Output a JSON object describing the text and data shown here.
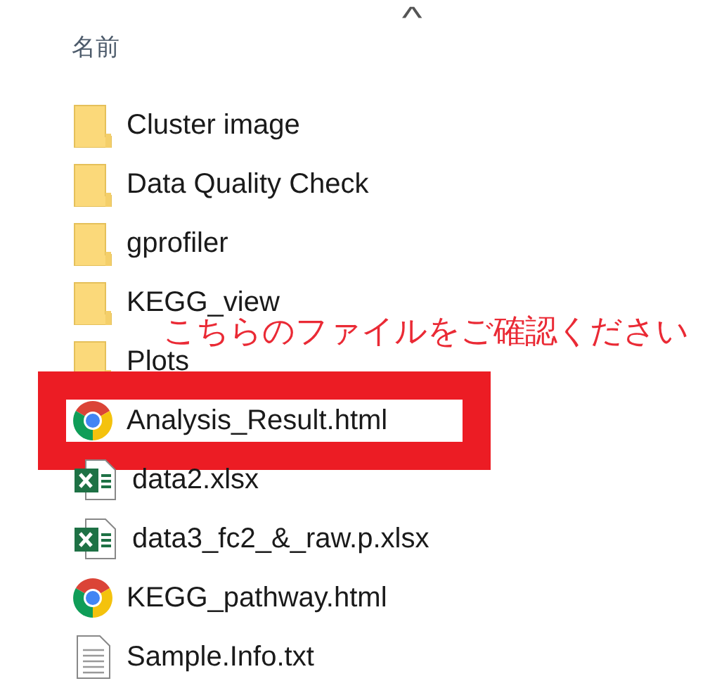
{
  "header": {
    "sort_caret": "^",
    "column": "名前"
  },
  "files": [
    {
      "name": "Cluster image",
      "kind": "folder",
      "highlighted": false
    },
    {
      "name": "Data Quality Check",
      "kind": "folder",
      "highlighted": false
    },
    {
      "name": "gprofiler",
      "kind": "folder",
      "highlighted": false
    },
    {
      "name": "KEGG_view",
      "kind": "folder",
      "highlighted": false
    },
    {
      "name": "Plots",
      "kind": "folder",
      "highlighted": false
    },
    {
      "name": "Analysis_Result.html",
      "kind": "chrome",
      "highlighted": true
    },
    {
      "name": "data2.xlsx",
      "kind": "excel",
      "highlighted": false
    },
    {
      "name": "data3_fc2_&_raw.p.xlsx",
      "kind": "excel",
      "highlighted": false
    },
    {
      "name": "KEGG_pathway.html",
      "kind": "chrome",
      "highlighted": false
    },
    {
      "name": "Sample.Info.txt",
      "kind": "text",
      "highlighted": false
    }
  ],
  "annotation": {
    "text": "こちらのファイルをご確認ください"
  }
}
